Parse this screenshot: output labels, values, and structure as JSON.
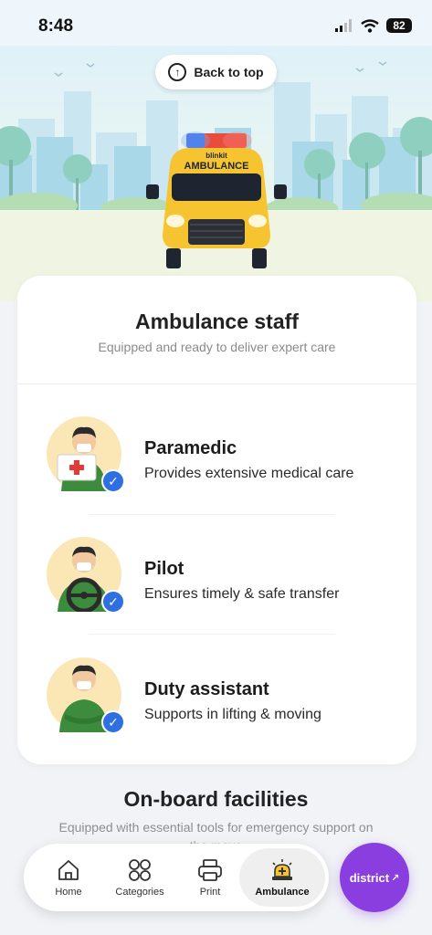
{
  "status_bar": {
    "time": "8:48",
    "battery": "82"
  },
  "hero": {
    "back_to_top": "Back to top",
    "ambulance_brand": "blinkit",
    "ambulance_label": "AMBULANCE"
  },
  "staff": {
    "title": "Ambulance staff",
    "subtitle": "Equipped and ready to deliver expert care",
    "members": [
      {
        "name": "Paramedic",
        "description": "Provides extensive medical care"
      },
      {
        "name": "Pilot",
        "description": "Ensures timely & safe transfer"
      },
      {
        "name": "Duty assistant",
        "description": "Supports in lifting & moving"
      }
    ]
  },
  "facilities": {
    "title": "On-board facilities",
    "subtitle": "Equipped with essential tools for emergency support on the move"
  },
  "nav": {
    "items": [
      {
        "label": "Home",
        "icon": "home-icon"
      },
      {
        "label": "Categories",
        "icon": "categories-icon"
      },
      {
        "label": "Print",
        "icon": "printer-icon"
      },
      {
        "label": "Ambulance",
        "icon": "ambulance-siren-icon"
      }
    ],
    "active": "Ambulance",
    "district": "district"
  },
  "colors": {
    "accent_blue": "#2f6fe4",
    "ambulance_yellow": "#f6c431",
    "district_purple": "#8a3ee0",
    "avatar_bg": "#fbe7b6"
  }
}
